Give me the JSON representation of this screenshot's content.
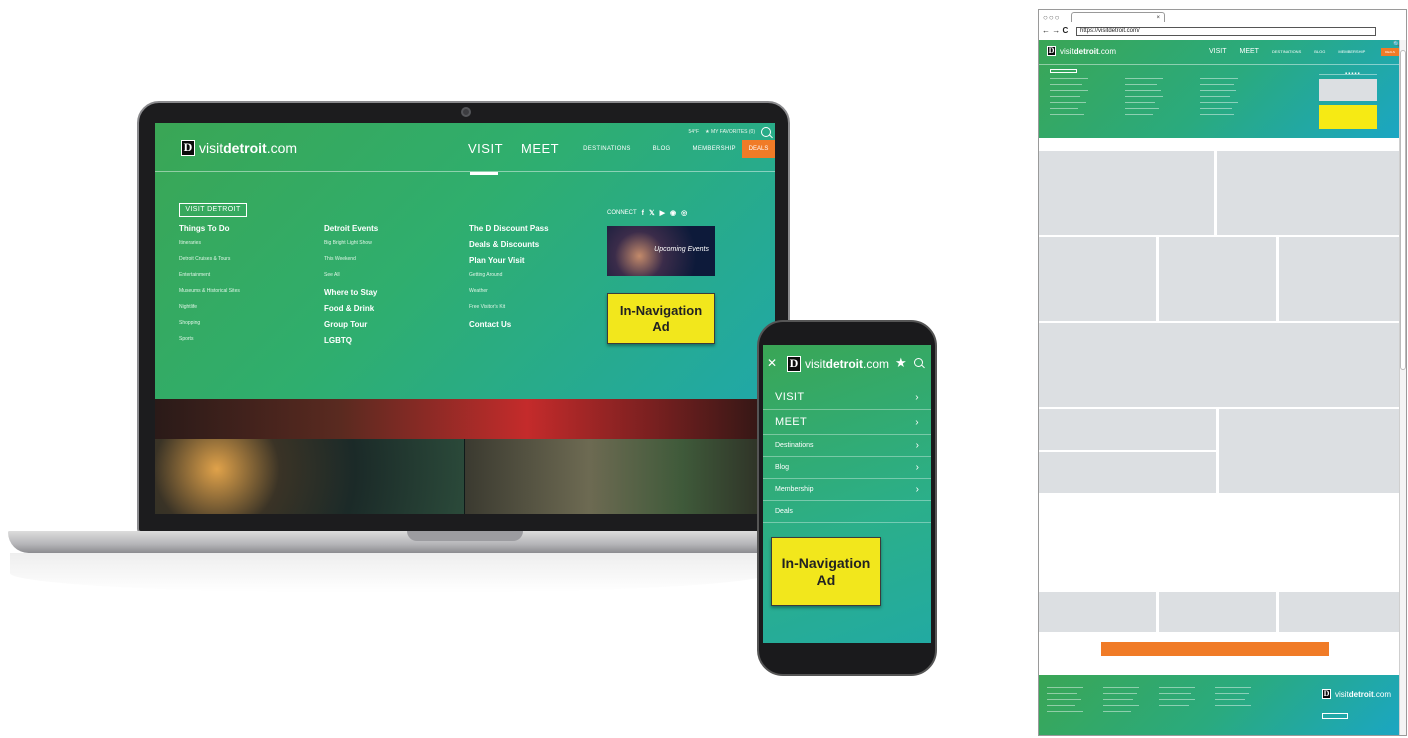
{
  "laptop": {
    "util": {
      "weather": "54°F",
      "favorites": "★ MY FAVORITES (0)"
    },
    "logo": {
      "mark": "D",
      "pre": "visit",
      "bold": "detroit",
      "post": ".com"
    },
    "nav": {
      "visit": "VISIT",
      "meet": "MEET",
      "destinations": "DESTINATIONS",
      "blog": "BLOG",
      "membership": "MEMBERSHIP",
      "deals": "DEALS"
    },
    "visit_button": "VISIT DETROIT",
    "col1": {
      "heading": "Things To Do",
      "items": [
        "Itineraries",
        "Detroit Cruises & Tours",
        "Entertainment",
        "Museums & Historical Sites",
        "Nightlife",
        "Shopping",
        "Sports"
      ]
    },
    "col2": {
      "heading1": "Detroit Events",
      "items": [
        "Big Bright Light Show",
        "This Weekend",
        "See All"
      ],
      "heading2": "Where to Stay",
      "heading3": "Food & Drink",
      "heading4": "Group Tour",
      "heading5": "LGBTQ"
    },
    "col3": {
      "heading1": "The D Discount Pass",
      "heading2": "Deals & Discounts",
      "heading3": "Plan Your Visit",
      "items": [
        "Getting Around",
        "Weather",
        "Free Visitor's Kit"
      ],
      "heading4": "Contact Us"
    },
    "connect_label": "CONNECT",
    "social_icons": [
      "facebook-icon",
      "twitter-icon",
      "youtube-icon",
      "pinterest-icon",
      "instagram-icon"
    ],
    "events_label": "Upcoming Events",
    "ad": {
      "line1": "In-Navigation",
      "line2": "Ad"
    }
  },
  "phone": {
    "close": "✕",
    "logo": {
      "mark": "D",
      "pre": "visit",
      "bold": "detroit",
      "post": ".com"
    },
    "menu": [
      "VISIT",
      "MEET",
      "Destinations",
      "Blog",
      "Membership",
      "Deals"
    ],
    "chevron": "›",
    "ad": {
      "line1": "In-Navigation",
      "line2": "Ad"
    }
  },
  "browser": {
    "dots": "○○○",
    "tab_close": "×",
    "nav_arrows": "← → C",
    "url": "https://visitdetroit.com/",
    "logo": {
      "mark": "D",
      "pre": "visit",
      "bold": "detroit",
      "post": ".com"
    },
    "links": {
      "visit": "VISIT",
      "meet": "MEET",
      "destinations": "DESTINATIONS",
      "blog": "BLOG",
      "membership": "MEMBERSHIP",
      "deals": "DEALS"
    },
    "search": "🔍",
    "dashes": "▪▪▪▪▪"
  },
  "colors": {
    "brand_green": "#3aa655",
    "brand_teal": "#20a8a8",
    "deals_orange": "#f07b27",
    "ad_yellow": "#f2e71c",
    "placeholder_gray": "#dcdfe2"
  }
}
